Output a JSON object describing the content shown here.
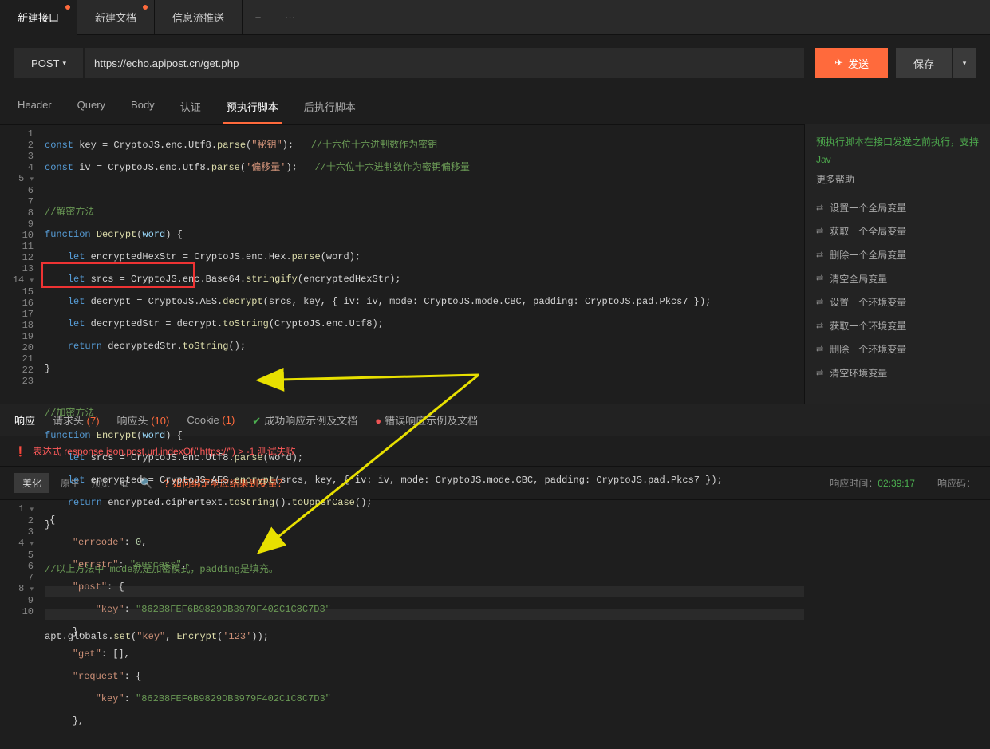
{
  "tabs": {
    "items": [
      {
        "label": "新建接口",
        "modified": true,
        "active": true
      },
      {
        "label": "新建文档",
        "modified": true,
        "active": false
      },
      {
        "label": "信息流推送",
        "modified": false,
        "active": false
      }
    ]
  },
  "request": {
    "method": "POST",
    "url": "https://echo.apipost.cn/get.php",
    "send_label": "发送",
    "save_label": "保存"
  },
  "sec_tabs": {
    "items": [
      "Header",
      "Query",
      "Body",
      "认证",
      "预执行脚本",
      "后执行脚本"
    ],
    "active_index": 4
  },
  "code": {
    "l1a": "const",
    "l1b": " key = CryptoJS.enc.Utf8.",
    "l1c": "parse",
    "l1d": "(",
    "l1e": "\"秘钥\"",
    "l1f": ");   ",
    "l1g": "//十六位十六进制数作为密钥",
    "l2a": "const",
    "l2b": " iv = CryptoJS.enc.Utf8.",
    "l2c": "parse",
    "l2d": "(",
    "l2e": "'偏移量'",
    "l2f": ");   ",
    "l2g": "//十六位十六进制数作为密钥偏移量",
    "l4": "//解密方法",
    "l5a": "function",
    "l5b": " ",
    "l5c": "Decrypt",
    "l5d": "(",
    "l5e": "word",
    "l5f": ") {",
    "l6a": "    let",
    "l6b": " encryptedHexStr = CryptoJS.enc.Hex.",
    "l6c": "parse",
    "l6d": "(word);",
    "l7a": "    let",
    "l7b": " srcs = CryptoJS.enc.Base64.",
    "l7c": "stringify",
    "l7d": "(encryptedHexStr);",
    "l8a": "    let",
    "l8b": " decrypt = CryptoJS.AES.",
    "l8c": "decrypt",
    "l8d": "(srcs, key, { iv: iv, mode: CryptoJS.mode.CBC, padding: CryptoJS.pad.Pkcs7 });",
    "l9a": "    let",
    "l9b": " decryptedStr = decrypt.",
    "l9c": "toString",
    "l9d": "(CryptoJS.enc.Utf8);",
    "l10a": "    return",
    "l10b": " decryptedStr.",
    "l10c": "toString",
    "l10d": "();",
    "l11": "}",
    "l13": "//加密方法",
    "l14a": "function",
    "l14b": " ",
    "l14c": "Encrypt",
    "l14d": "(",
    "l14e": "word",
    "l14f": ") {",
    "l15a": "    let",
    "l15b": " srcs = CryptoJS.enc.Utf8.",
    "l15c": "parse",
    "l15d": "(word);",
    "l16a": "    let",
    "l16b": " encrypted = CryptoJS.AES.",
    "l16c": "encrypt",
    "l16d": "(srcs, key, { iv: iv, mode: CryptoJS.mode.CBC, padding: CryptoJS.pad.Pkcs7 });",
    "l17a": "    return",
    "l17b": " encrypted.ciphertext.",
    "l17c": "toString",
    "l17d": "().",
    "l17e": "toUpperCase",
    "l17f": "();",
    "l18": "}",
    "l20": "//以上方法中 mode就是加密模式，padding是填充。",
    "l23a": "apt.globals.",
    "l23b": "set",
    "l23c": "(",
    "l23d": "\"key\"",
    "l23e": ", ",
    "l23f": "Encrypt",
    "l23g": "(",
    "l23h": "'123'",
    "l23i": "));"
  },
  "side": {
    "title": "预执行脚本在接口发送之前执行，支持Jav",
    "sub": "更多帮助",
    "items": [
      "设置一个全局变量",
      "获取一个全局变量",
      "删除一个全局变量",
      "清空全局变量",
      "设置一个环境变量",
      "获取一个环境变量",
      "删除一个环境变量",
      "清空环境变量"
    ]
  },
  "resp_tabs": {
    "response": "响应",
    "req_headers": "请求头",
    "req_headers_count": "(7)",
    "resp_headers": "响应头",
    "resp_headers_count": "(10)",
    "cookie": "Cookie",
    "cookie_count": "(1)",
    "success_doc": "成功响应示例及文档",
    "error_doc": "错误响应示例及文档"
  },
  "assertion": {
    "text": "表达式 response.json.post.url.indexOf(\"https://\") > -1 测试失败"
  },
  "resp_toolbar": {
    "beautify": "美化",
    "raw": "原生",
    "preview": "预览",
    "bind_hint": "如何绑定响应结果到变量？",
    "time_label": "响应时间：",
    "time_value": "02:39:17",
    "code_label": "响应码："
  },
  "resp_body": {
    "l1": "{",
    "l2k": "\"errcode\"",
    "l2v": "0",
    "l3k": "\"errstr\"",
    "l3v": "\"success\"",
    "l4k": "\"post\"",
    "l4v": "{",
    "l5k": "\"key\"",
    "l5v": "\"862B8FEF6B9829DB3979F402C1C8C7D3\"",
    "l6": "},",
    "l7k": "\"get\"",
    "l7v": "[]",
    "l8k": "\"request\"",
    "l8v": "{",
    "l9k": "\"key\"",
    "l9v": "\"862B8FEF6B9829DB3979F402C1C8C7D3\"",
    "l10": "},"
  }
}
